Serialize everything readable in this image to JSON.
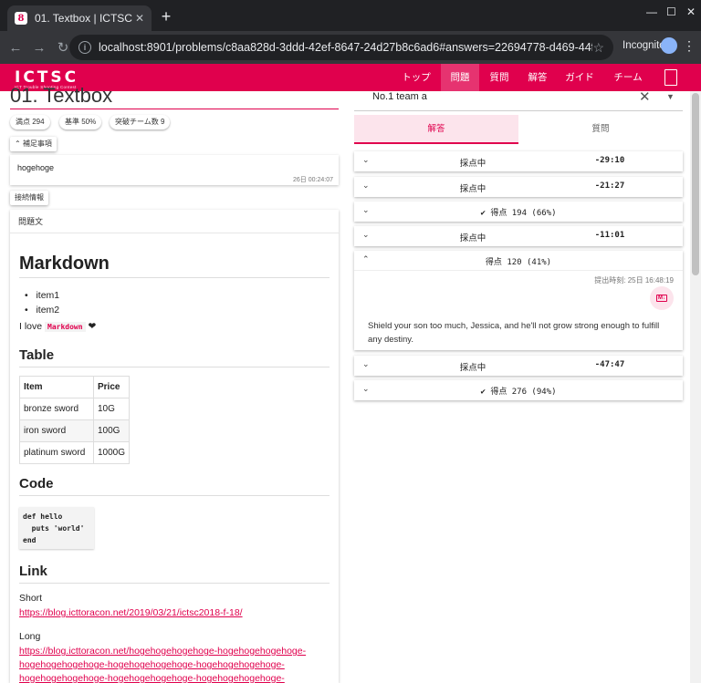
{
  "browser": {
    "tab_title": "01. Textbox | ICTSC",
    "url": "localhost:8901/problems/c8aa828d-3ddd-42ef-8647-24d27b8c6ad6#answers=22694778-d469-44fa-89b6-1c22e4ea8bc5",
    "incognito_label": "Incognito",
    "favicon_letter": "8"
  },
  "app": {
    "logo_text": "ICTSC",
    "logo_subtitle": "ICT Trouble Shooting Contest",
    "brand_color": "#e0004d",
    "nav": [
      "トップ",
      "問題",
      "質問",
      "解答",
      "ガイド",
      "チーム"
    ],
    "active_nav": "問題"
  },
  "problem": {
    "title": "01. Textbox",
    "chips": [
      "満点  294",
      "基準  50%",
      "突破チーム数  9"
    ],
    "supplement_toggle": "補足事項",
    "supplement_text": "hogehoge",
    "supplement_time": "26日 00:24:07",
    "connection_button": "接続情報",
    "body_header": "問題文"
  },
  "markdown": {
    "h1": "Markdown",
    "list": [
      "item1",
      "item2"
    ],
    "love_text": "I love",
    "love_code": "Markdown",
    "heart": "❤",
    "table_heading": "Table",
    "table_headers": [
      "Item",
      "Price"
    ],
    "table_rows": [
      [
        "bronze sword",
        "10G"
      ],
      [
        "iron sword",
        "100G"
      ],
      [
        "platinum sword",
        "1000G"
      ]
    ],
    "code_heading": "Code",
    "code_block": "def hello\n  puts 'world'\nend",
    "link_heading": "Link",
    "short_label": "Short",
    "short_link": "https://blog.icttoracon.net/2019/03/21/ictsc2018-f-18/",
    "long_label": "Long",
    "long_link_1": "https://blog.icttoracon.net/hogehogehogehoge-hogehogehogehoge-",
    "long_link_2": "hogehogehogehoge-hogehogehogehoge-hogehogehogehoge-",
    "long_link_3": "hogehogehogehoge-hogehogehogehoge-hogehogehogehoge-"
  },
  "answers": {
    "team": "No.1 team a",
    "tabs": [
      "解答",
      "質問"
    ],
    "rows": [
      {
        "status": "採点中",
        "time": "-29:10"
      },
      {
        "status": "採点中",
        "time": "-21:27"
      },
      {
        "score": "✔ 得点 194 (66%)"
      },
      {
        "status": "採点中",
        "time": "-11:01"
      }
    ],
    "expanded": {
      "score": "得点 120 (41%)",
      "submitted": "提出時刻: 25日 16:48:19",
      "badge": "M↓",
      "message": "Shield your son too much, Jessica, and he'll not grow strong enough to fulfill any destiny."
    },
    "rows_after": [
      {
        "status": "採点中",
        "time": "-47:47"
      },
      {
        "score": "✔ 得点 276 (94%)"
      }
    ]
  }
}
